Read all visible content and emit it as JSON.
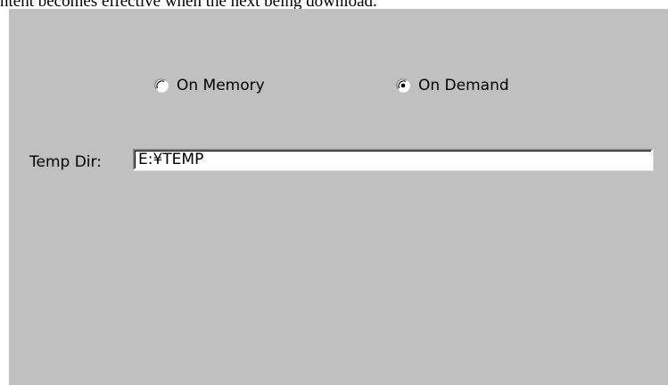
{
  "caption": "ntent becomes effective when the next being download.",
  "storage_mode": {
    "options": [
      {
        "label": "On Memory",
        "selected": false
      },
      {
        "label": "On Demand",
        "selected": true
      }
    ]
  },
  "temp_dir": {
    "label": "Temp Dir:",
    "value": "E:¥TEMP"
  },
  "colors": {
    "panel_background": "#c0c0c0",
    "input_background": "#ffffff"
  }
}
